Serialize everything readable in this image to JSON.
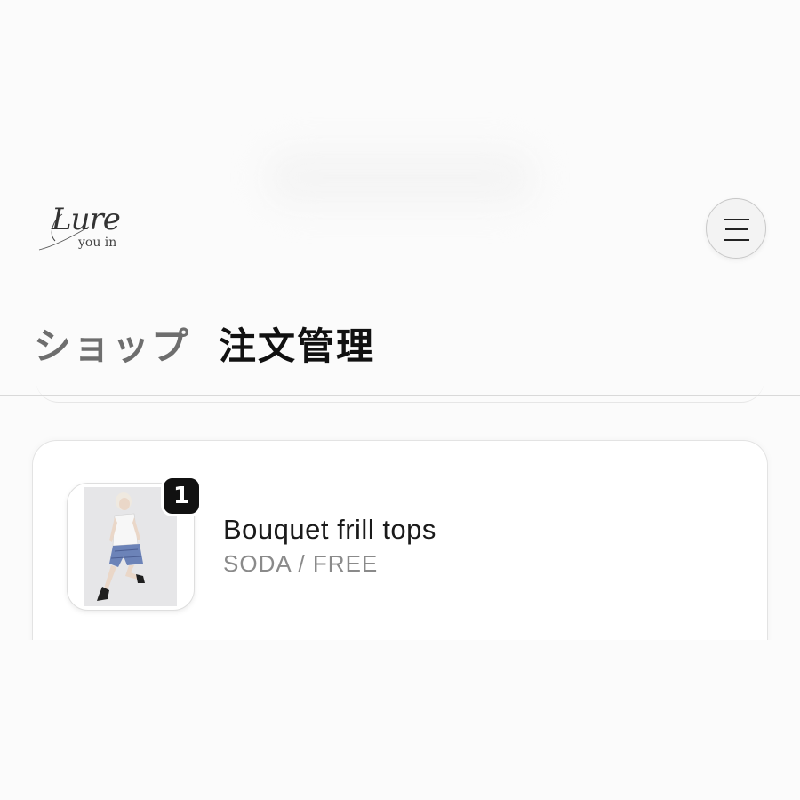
{
  "header": {
    "logo": {
      "script_text": "Lure",
      "sub_text": "you in"
    },
    "menu_icon": "hamburger-menu-icon"
  },
  "tabs": [
    {
      "label": "ショップ",
      "active": false
    },
    {
      "label": "注文管理",
      "active": true
    }
  ],
  "order_items": [
    {
      "quantity": "1",
      "name": "Bouquet frill tops",
      "variant": "SODA / FREE"
    }
  ]
}
